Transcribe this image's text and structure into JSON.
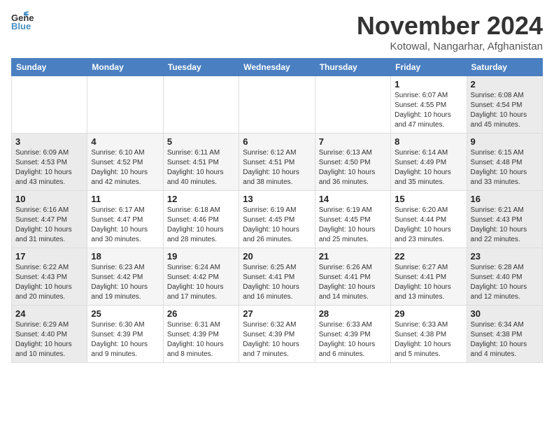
{
  "header": {
    "logo_line1": "General",
    "logo_line2": "Blue",
    "month_title": "November 2024",
    "location": "Kotowal, Nangarhar, Afghanistan"
  },
  "weekdays": [
    "Sunday",
    "Monday",
    "Tuesday",
    "Wednesday",
    "Thursday",
    "Friday",
    "Saturday"
  ],
  "weeks": [
    [
      {
        "day": "",
        "info": ""
      },
      {
        "day": "",
        "info": ""
      },
      {
        "day": "",
        "info": ""
      },
      {
        "day": "",
        "info": ""
      },
      {
        "day": "",
        "info": ""
      },
      {
        "day": "1",
        "info": "Sunrise: 6:07 AM\nSunset: 4:55 PM\nDaylight: 10 hours\nand 47 minutes."
      },
      {
        "day": "2",
        "info": "Sunrise: 6:08 AM\nSunset: 4:54 PM\nDaylight: 10 hours\nand 45 minutes."
      }
    ],
    [
      {
        "day": "3",
        "info": "Sunrise: 6:09 AM\nSunset: 4:53 PM\nDaylight: 10 hours\nand 43 minutes."
      },
      {
        "day": "4",
        "info": "Sunrise: 6:10 AM\nSunset: 4:52 PM\nDaylight: 10 hours\nand 42 minutes."
      },
      {
        "day": "5",
        "info": "Sunrise: 6:11 AM\nSunset: 4:51 PM\nDaylight: 10 hours\nand 40 minutes."
      },
      {
        "day": "6",
        "info": "Sunrise: 6:12 AM\nSunset: 4:51 PM\nDaylight: 10 hours\nand 38 minutes."
      },
      {
        "day": "7",
        "info": "Sunrise: 6:13 AM\nSunset: 4:50 PM\nDaylight: 10 hours\nand 36 minutes."
      },
      {
        "day": "8",
        "info": "Sunrise: 6:14 AM\nSunset: 4:49 PM\nDaylight: 10 hours\nand 35 minutes."
      },
      {
        "day": "9",
        "info": "Sunrise: 6:15 AM\nSunset: 4:48 PM\nDaylight: 10 hours\nand 33 minutes."
      }
    ],
    [
      {
        "day": "10",
        "info": "Sunrise: 6:16 AM\nSunset: 4:47 PM\nDaylight: 10 hours\nand 31 minutes."
      },
      {
        "day": "11",
        "info": "Sunrise: 6:17 AM\nSunset: 4:47 PM\nDaylight: 10 hours\nand 30 minutes."
      },
      {
        "day": "12",
        "info": "Sunrise: 6:18 AM\nSunset: 4:46 PM\nDaylight: 10 hours\nand 28 minutes."
      },
      {
        "day": "13",
        "info": "Sunrise: 6:19 AM\nSunset: 4:45 PM\nDaylight: 10 hours\nand 26 minutes."
      },
      {
        "day": "14",
        "info": "Sunrise: 6:19 AM\nSunset: 4:45 PM\nDaylight: 10 hours\nand 25 minutes."
      },
      {
        "day": "15",
        "info": "Sunrise: 6:20 AM\nSunset: 4:44 PM\nDaylight: 10 hours\nand 23 minutes."
      },
      {
        "day": "16",
        "info": "Sunrise: 6:21 AM\nSunset: 4:43 PM\nDaylight: 10 hours\nand 22 minutes."
      }
    ],
    [
      {
        "day": "17",
        "info": "Sunrise: 6:22 AM\nSunset: 4:43 PM\nDaylight: 10 hours\nand 20 minutes."
      },
      {
        "day": "18",
        "info": "Sunrise: 6:23 AM\nSunset: 4:42 PM\nDaylight: 10 hours\nand 19 minutes."
      },
      {
        "day": "19",
        "info": "Sunrise: 6:24 AM\nSunset: 4:42 PM\nDaylight: 10 hours\nand 17 minutes."
      },
      {
        "day": "20",
        "info": "Sunrise: 6:25 AM\nSunset: 4:41 PM\nDaylight: 10 hours\nand 16 minutes."
      },
      {
        "day": "21",
        "info": "Sunrise: 6:26 AM\nSunset: 4:41 PM\nDaylight: 10 hours\nand 14 minutes."
      },
      {
        "day": "22",
        "info": "Sunrise: 6:27 AM\nSunset: 4:41 PM\nDaylight: 10 hours\nand 13 minutes."
      },
      {
        "day": "23",
        "info": "Sunrise: 6:28 AM\nSunset: 4:40 PM\nDaylight: 10 hours\nand 12 minutes."
      }
    ],
    [
      {
        "day": "24",
        "info": "Sunrise: 6:29 AM\nSunset: 4:40 PM\nDaylight: 10 hours\nand 10 minutes."
      },
      {
        "day": "25",
        "info": "Sunrise: 6:30 AM\nSunset: 4:39 PM\nDaylight: 10 hours\nand 9 minutes."
      },
      {
        "day": "26",
        "info": "Sunrise: 6:31 AM\nSunset: 4:39 PM\nDaylight: 10 hours\nand 8 minutes."
      },
      {
        "day": "27",
        "info": "Sunrise: 6:32 AM\nSunset: 4:39 PM\nDaylight: 10 hours\nand 7 minutes."
      },
      {
        "day": "28",
        "info": "Sunrise: 6:33 AM\nSunset: 4:39 PM\nDaylight: 10 hours\nand 6 minutes."
      },
      {
        "day": "29",
        "info": "Sunrise: 6:33 AM\nSunset: 4:38 PM\nDaylight: 10 hours\nand 5 minutes."
      },
      {
        "day": "30",
        "info": "Sunrise: 6:34 AM\nSunset: 4:38 PM\nDaylight: 10 hours\nand 4 minutes."
      }
    ]
  ]
}
